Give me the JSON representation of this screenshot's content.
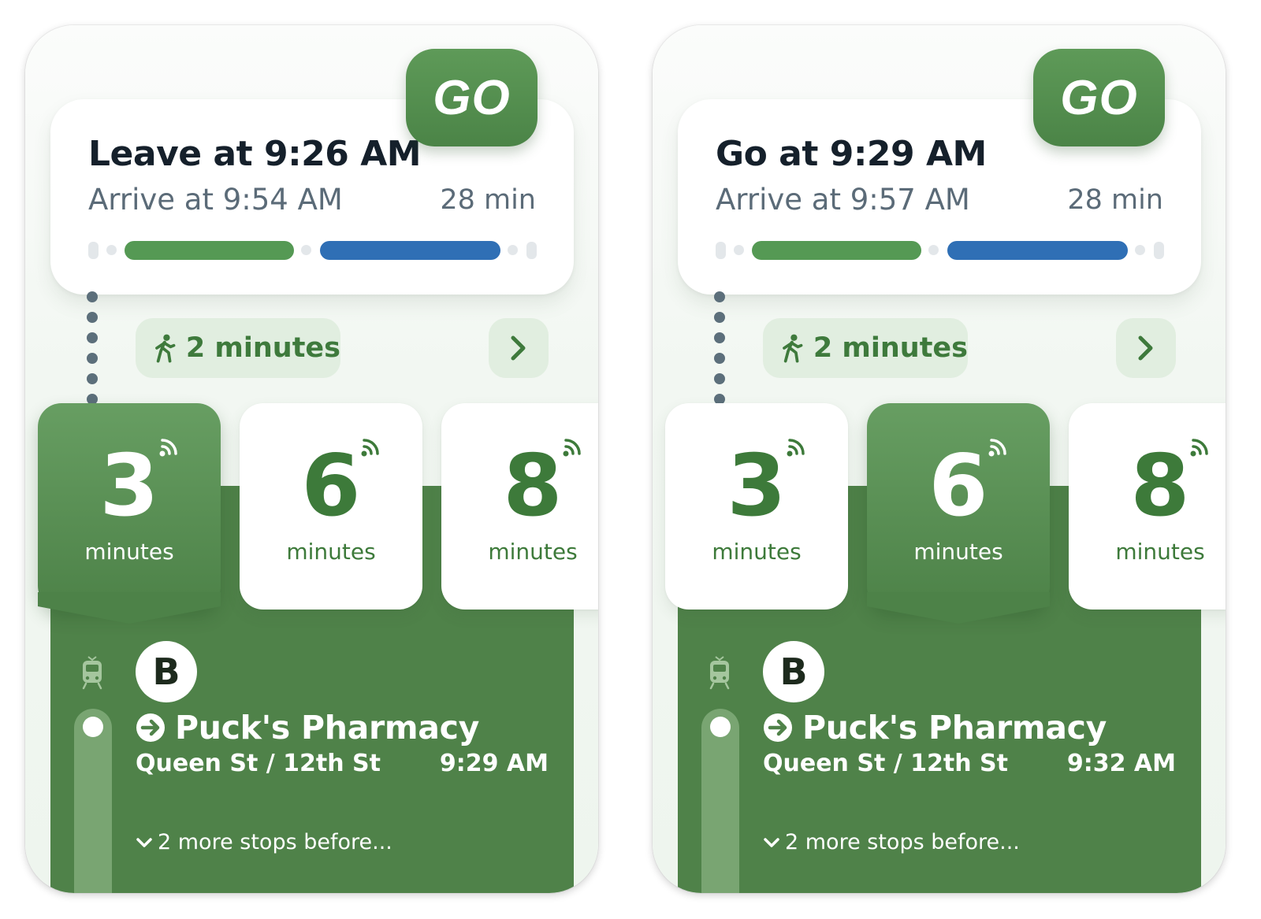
{
  "colors": {
    "brand_green": "#4f8249",
    "walk_bar": "#559954",
    "transit_bar": "#2f6fb5",
    "pill_bg": "#e1eee0",
    "title_text": "#15202b",
    "secondary_text": "#5b6b78"
  },
  "screens": [
    {
      "summary": {
        "leave_label": "Leave at 9:26 AM",
        "arrive_label": "Arrive at 9:54 AM",
        "duration": "28 min"
      },
      "go_button": {
        "label": "GO"
      },
      "walk": {
        "label": "2 minutes",
        "icon": "walking-person-icon"
      },
      "departures": [
        {
          "number": "3",
          "unit": "minutes",
          "selected": true,
          "icon": "realtime-signal-icon"
        },
        {
          "number": "6",
          "unit": "minutes",
          "selected": false,
          "icon": "realtime-signal-icon"
        },
        {
          "number": "8",
          "unit": "minutes",
          "selected": false,
          "icon": "realtime-signal-icon"
        }
      ],
      "transit": {
        "route": "B",
        "stop_name": "Puck's Pharmacy",
        "street": "Queen St / 12th St",
        "time": "9:29 AM",
        "more_stops": "2 more stops before..."
      }
    },
    {
      "summary": {
        "leave_label": "Go at 9:29 AM",
        "arrive_label": "Arrive at 9:57 AM",
        "duration": "28 min"
      },
      "go_button": {
        "label": "GO"
      },
      "walk": {
        "label": "2 minutes",
        "icon": "walking-person-icon"
      },
      "departures": [
        {
          "number": "3",
          "unit": "minutes",
          "selected": false,
          "icon": "realtime-signal-icon"
        },
        {
          "number": "6",
          "unit": "minutes",
          "selected": true,
          "icon": "realtime-signal-icon"
        },
        {
          "number": "8",
          "unit": "minutes",
          "selected": false,
          "icon": "realtime-signal-icon"
        }
      ],
      "transit": {
        "route": "B",
        "stop_name": "Puck's Pharmacy",
        "street": "Queen St / 12th St",
        "time": "9:32 AM",
        "more_stops": "2 more stops before..."
      }
    }
  ]
}
